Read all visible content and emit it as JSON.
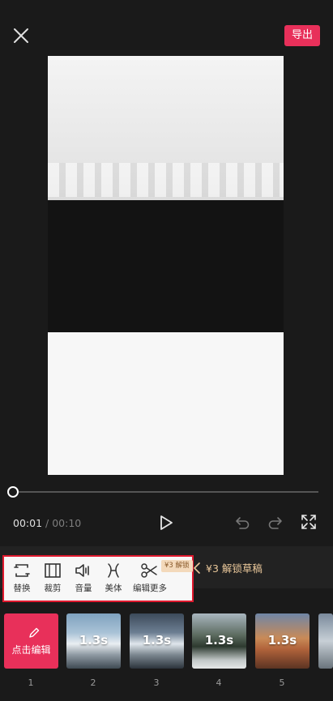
{
  "header": {
    "close_icon": "close-icon",
    "export_label": "导出",
    "accent": "#e8305a"
  },
  "player": {
    "current_time": "00:01",
    "separator": "/",
    "total_time": "00:10",
    "progress": 0.0
  },
  "toolbar": {
    "tools": [
      {
        "label": "替换",
        "icon": "replace-icon"
      },
      {
        "label": "裁剪",
        "icon": "crop-icon"
      },
      {
        "label": "音量",
        "icon": "volume-icon"
      },
      {
        "label": "美体",
        "icon": "body-beauty-icon"
      },
      {
        "label": "编辑更多",
        "icon": "scissors-icon"
      }
    ],
    "vip_badge": "¥3 解锁",
    "unlock_text": "¥3 解锁草稿"
  },
  "clips": {
    "first_label": "点击编辑",
    "items": [
      {
        "number": "1",
        "duration": ""
      },
      {
        "number": "2",
        "duration": "1.3s"
      },
      {
        "number": "3",
        "duration": "1.3s"
      },
      {
        "number": "4",
        "duration": "1.3s"
      },
      {
        "number": "5",
        "duration": "1.3s"
      }
    ]
  }
}
